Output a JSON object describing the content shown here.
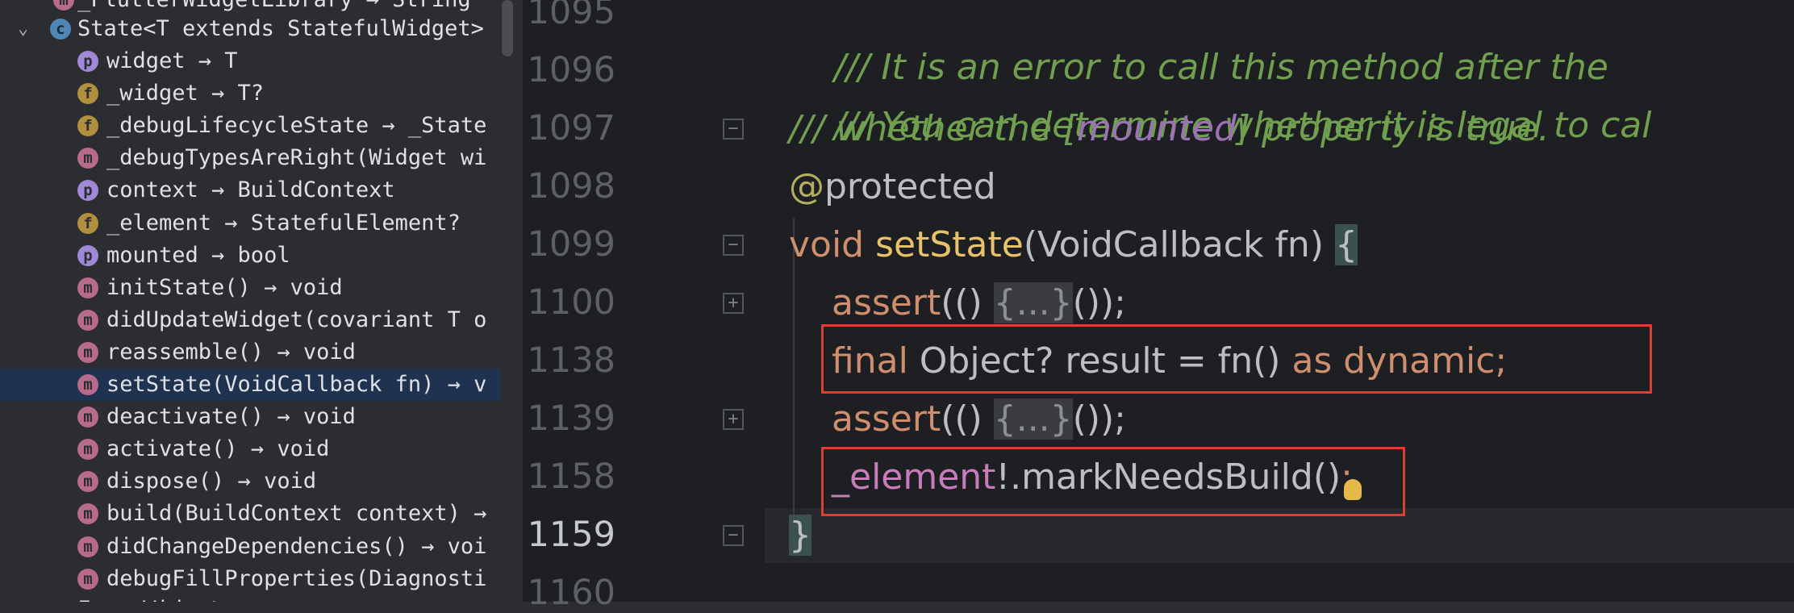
{
  "structure": {
    "partial_top": "_FlutterWidgetLibrary → String",
    "partial_bottom": "FocusWidget",
    "class_node": {
      "badge": "c",
      "label": "State<T extends StatefulWidget>"
    },
    "items": [
      {
        "badge": "p",
        "label": "widget → T"
      },
      {
        "badge": "f",
        "label": "_widget → T?"
      },
      {
        "badge": "f",
        "label": "_debugLifecycleState → _State"
      },
      {
        "badge": "m",
        "label": "_debugTypesAreRight(Widget wi"
      },
      {
        "badge": "p",
        "label": "context → BuildContext"
      },
      {
        "badge": "f",
        "label": "_element → StatefulElement?"
      },
      {
        "badge": "p",
        "label": "mounted → bool"
      },
      {
        "badge": "m",
        "label": "initState() → void"
      },
      {
        "badge": "m",
        "label": "didUpdateWidget(covariant T o"
      },
      {
        "badge": "m",
        "label": "reassemble() → void"
      },
      {
        "badge": "m",
        "label": "setState(VoidCallback fn) → v",
        "selected": true
      },
      {
        "badge": "m",
        "label": "deactivate() → void"
      },
      {
        "badge": "m",
        "label": "activate() → void"
      },
      {
        "badge": "m",
        "label": "dispose() → void"
      },
      {
        "badge": "m",
        "label": "build(BuildContext context) →"
      },
      {
        "badge": "m",
        "label": "didChangeDependencies() → voi"
      },
      {
        "badge": "m",
        "label": "debugFillProperties(Diagnosti"
      }
    ]
  },
  "editor": {
    "line_numbers": [
      "1095",
      "1096",
      "1097",
      "1098",
      "1099",
      "1100",
      "1138",
      "1139",
      "1158",
      "1159",
      "1160"
    ],
    "current_line": "1159",
    "lines": {
      "l1095": "/// It is an error to call this method after the",
      "l1096": "/// You can determine whether it is legal to cal",
      "l1097a": "/// whether the [",
      "l1097b": "mounted",
      "l1097c": "] property is true.",
      "l1098a": "@",
      "l1098b": "protected",
      "l1099a": "void ",
      "l1099b": "setState",
      "l1099c": "(VoidCallback fn) ",
      "l1099d": "{",
      "l1100a": "assert",
      "l1100b": "(() ",
      "l1100c": "{...}",
      "l1100d": "());",
      "l1138a": "final ",
      "l1138b": "Object? result = fn() ",
      "l1138c": "as dynamic;",
      "l1139a": "assert",
      "l1139b": "(() ",
      "l1139c": "{...}",
      "l1139d": "());",
      "l1158a": "_element",
      "l1158b": "!.markNeedsBuild()",
      "l1158c": ";",
      "l1159": "}"
    }
  },
  "colors": {
    "highlight_box": "#d8402f",
    "comment": "#6f9f4f",
    "keyword": "#cf8e6d",
    "function": "#e8c26a",
    "field": "#c77dbb"
  }
}
